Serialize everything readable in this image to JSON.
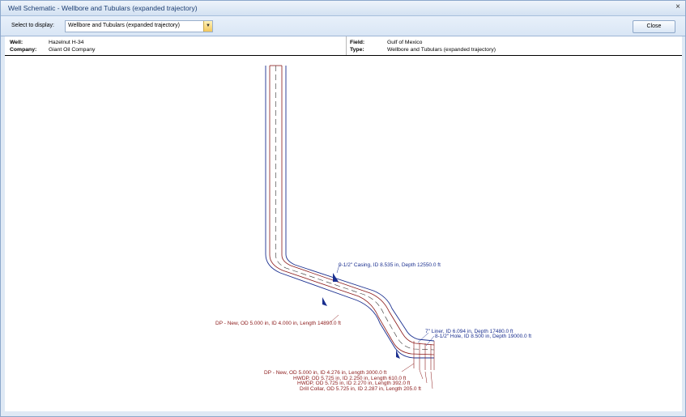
{
  "window": {
    "title": "Well Schematic - Wellbore and Tubulars (expanded trajectory)",
    "close_glyph": "×"
  },
  "toolbar": {
    "select_label": "Select to display:",
    "selected_value": "Wellbore and Tubulars (expanded trajectory)",
    "dropdown_icon": "chevron-down-icon",
    "close_label": "Close"
  },
  "info": {
    "well_label": "Well:",
    "well": "Hazelnut H-34",
    "company_label": "Company:",
    "company": "Giant Oil Company",
    "field_label": "Field:",
    "field": "Gulf of Mexico",
    "type_label": "Type:",
    "type": "Wellbore and Tubulars (expanded trajectory)"
  },
  "schematic": {
    "casing_color": "#1a2f8f",
    "tubular_color": "#8b1a1a",
    "labels": {
      "casing": "9-1/2\" Casing, ID 8.535 in, Depth 12550.0 ft",
      "dp1": "DP - New, OD 5.000 in, ID 4.000 in, Length 14890.0 ft",
      "liner": "7\" Liner, ID 6.094 in, Depth 17480.0 ft",
      "hole": "8-1/2\" Hole, ID 8.500 in, Depth 19000.0 ft",
      "dp2": "DP - New, OD 5.000 in, ID 4.276 in, Length 3000.0 ft",
      "hwdp1": "HWDP, OD 5.725 in, ID 2.250 in, Length 610.0 ft",
      "hwdp2": "HWDP, OD 5.725 in, ID 2.270 in, Length 392.0 ft",
      "collar": "Drill Collar, OD 5.725 in, ID 2.287 in, Length 205.0 ft"
    }
  }
}
